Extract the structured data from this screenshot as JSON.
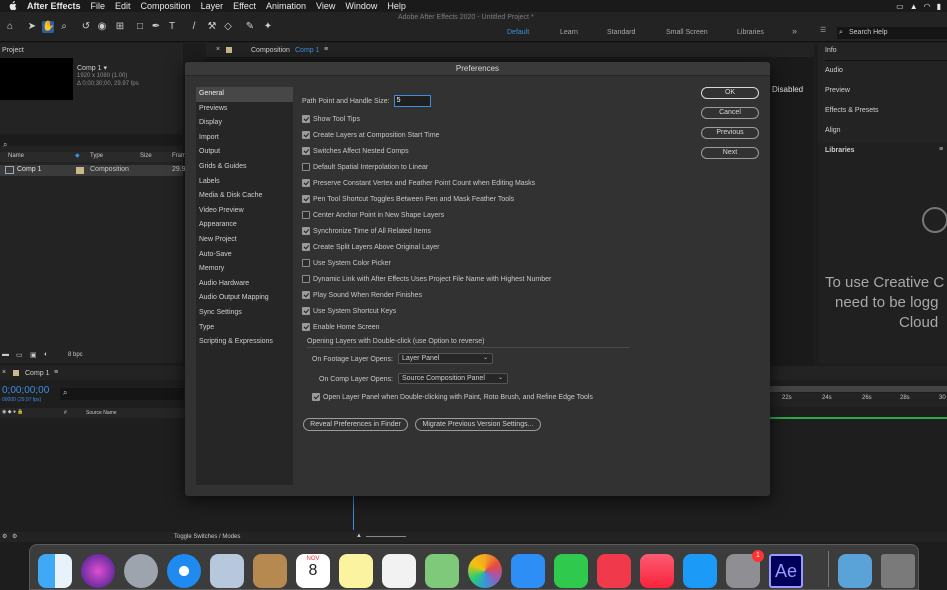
{
  "menubar": {
    "app": "After Effects",
    "items": [
      "File",
      "Edit",
      "Composition",
      "Layer",
      "Effect",
      "Animation",
      "View",
      "Window",
      "Help"
    ]
  },
  "window_title": "Adobe After Effects 2020 - Untitled Project *",
  "workspaces": [
    "Default",
    "Learn",
    "Standard",
    "Small Screen",
    "Libraries"
  ],
  "search_help": "Search Help",
  "project_panel": {
    "title": "Project",
    "comp_name": "Comp 1 ▾",
    "comp_size": "1920 x 1080 (1.00)",
    "comp_duration": "Δ 0;00;30;00, 29.97 fps",
    "col_name": "Name",
    "col_type": "Type",
    "col_size": "Size",
    "col_frame": "Fram",
    "row_name": "Comp 1",
    "row_type": "Composition",
    "row_fps": "29.9",
    "bpc": "8 bpc"
  },
  "comp_panel": {
    "title": "Composition",
    "comp_link": "Comp 1",
    "disabled_label": "Disabled"
  },
  "right_panels": [
    "Info",
    "Audio",
    "Preview",
    "Effects & Presets",
    "Align"
  ],
  "libraries": {
    "title": "Libraries",
    "message_lines": [
      "To use Creative C",
      "need to be logg",
      "Cloud"
    ]
  },
  "timeline": {
    "tab": "Comp 1",
    "timecode": "0;00;00;00",
    "fps": "00000 (29.97 fps)",
    "source_name": "Source Name",
    "ticks": [
      "22s",
      "24s",
      "26s",
      "28s",
      "30"
    ],
    "toggle": "Toggle Switches / Modes"
  },
  "preferences": {
    "title": "Preferences",
    "categories": [
      "General",
      "Previews",
      "Display",
      "Import",
      "Output",
      "Grids & Guides",
      "Labels",
      "Media & Disk Cache",
      "Video Preview",
      "Appearance",
      "New Project",
      "Auto-Save",
      "Memory",
      "Audio Hardware",
      "Audio Output Mapping",
      "Sync Settings",
      "Type",
      "Scripting & Expressions"
    ],
    "selected_category": "General",
    "handle_size_label": "Path Point and Handle Size:",
    "handle_size_value": "5",
    "options": [
      {
        "label": "Show Tool Tips",
        "checked": true
      },
      {
        "label": "Create Layers at Composition Start Time",
        "checked": true
      },
      {
        "label": "Switches Affect Nested Comps",
        "checked": true
      },
      {
        "label": "Default Spatial Interpolation to Linear",
        "checked": false
      },
      {
        "label": "Preserve Constant Vertex and Feather Point Count when Editing Masks",
        "checked": true
      },
      {
        "label": "Pen Tool Shortcut Toggles Between Pen and Mask Feather Tools",
        "checked": true
      },
      {
        "label": "Center Anchor Point in New Shape Layers",
        "checked": false
      },
      {
        "label": "Synchronize Time of All Related Items",
        "checked": true
      },
      {
        "label": "Create Split Layers Above Original Layer",
        "checked": true
      },
      {
        "label": "Use System Color Picker",
        "checked": false
      },
      {
        "label": "Dynamic Link with After Effects Uses Project File Name with Highest Number",
        "checked": false
      },
      {
        "label": "Play Sound When Render Finishes",
        "checked": true
      },
      {
        "label": "Use System Shortcut Keys",
        "checked": true
      },
      {
        "label": "Enable Home Screen",
        "checked": true
      }
    ],
    "opening_layers_heading": "Opening Layers with Double-click (use Option to reverse)",
    "footage_label": "On Footage Layer Opens:",
    "footage_value": "Layer Panel",
    "comp_label": "On Comp Layer Opens:",
    "comp_value": "Source Composition Panel",
    "open_layer_panel_label": "Open Layer Panel when Double-clicking with Paint, Roto Brush, and Refine Edge Tools",
    "open_layer_panel_checked": true,
    "buttons": {
      "ok": "OK",
      "cancel": "Cancel",
      "previous": "Previous",
      "next": "Next"
    },
    "reveal_button": "Reveal Preferences in Finder",
    "migrate_button": "Migrate Previous Version Settings..."
  },
  "dock": {
    "calendar_month": "NOV",
    "calendar_day": "8",
    "sysprefs_badge": "1",
    "ae_label": "Ae"
  },
  "colors": {
    "accent": "#3d8ee0",
    "panel_bg": "#232323",
    "dialog_bg": "#323232",
    "ae_purple": "#9999ff"
  }
}
